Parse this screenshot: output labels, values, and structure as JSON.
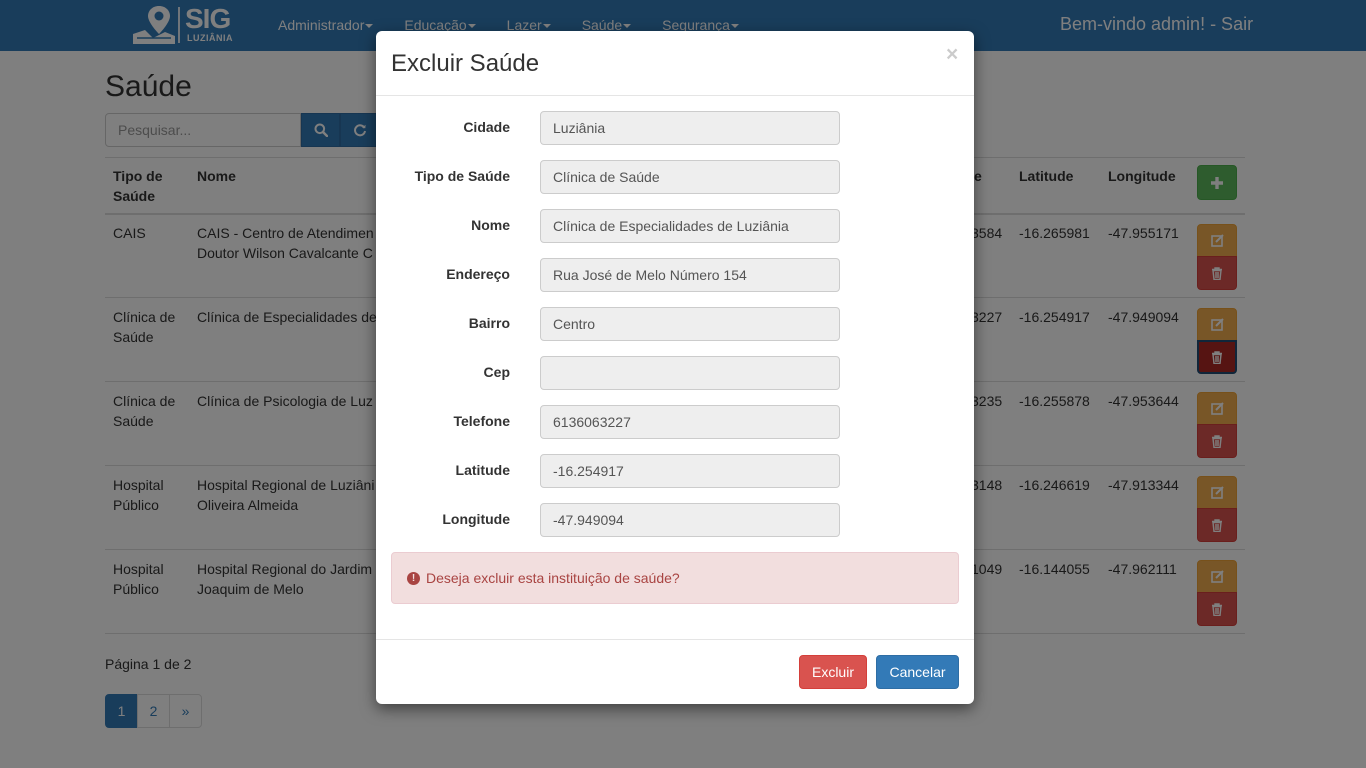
{
  "brand": {
    "name": "SIG",
    "city": "LUZIÂNIA"
  },
  "nav": {
    "items": [
      "Administrador",
      "Educação",
      "Lazer",
      "Saúde",
      "Segurança"
    ],
    "welcome": "Bem-vindo admin! - Sair"
  },
  "page": {
    "title": "Saúde"
  },
  "search": {
    "placeholder": "Pesquisar..."
  },
  "table": {
    "headers": {
      "tipo_line1": "Tipo de",
      "tipo_line2": "Saúde",
      "nome": "Nome",
      "telefone_tail": "e",
      "latitude": "Latitude",
      "longitude": "Longitude"
    },
    "rows": [
      {
        "tipo1": "CAIS",
        "tipo2": "",
        "nome1": "CAIS - Centro de Atendimen",
        "nome2": "Doutor Wilson Cavalcante C",
        "tel": "3584",
        "lat": "-16.265981",
        "lng": "-47.955171"
      },
      {
        "tipo1": "Clínica de",
        "tipo2": "Saúde",
        "nome1": "Clínica de Especialidades de",
        "nome2": "",
        "tel": "3227",
        "lat": "-16.254917",
        "lng": "-47.949094"
      },
      {
        "tipo1": "Clínica de",
        "tipo2": "Saúde",
        "nome1": "Clínica de Psicologia de Luz",
        "nome2": "",
        "tel": "3235",
        "lat": "-16.255878",
        "lng": "-47.953644"
      },
      {
        "tipo1": "Hospital",
        "tipo2": "Público",
        "nome1": "Hospital Regional de Luziâni",
        "nome2": "Oliveira Almeida",
        "tel": "3148",
        "lat": "-16.246619",
        "lng": "-47.913344"
      },
      {
        "tipo1": "Hospital",
        "tipo2": "Público",
        "nome1": "Hospital Regional do Jardim",
        "nome2": "Joaquim de Melo",
        "tel": "1049",
        "lat": "-16.144055",
        "lng": "-47.962111"
      }
    ]
  },
  "pagination": {
    "info": "Página 1 de 2",
    "pages": [
      "1",
      "2",
      "»"
    ]
  },
  "modal": {
    "title": "Excluir Saúde",
    "close": "×",
    "fields": [
      {
        "label": "Cidade",
        "value": "Luziânia"
      },
      {
        "label": "Tipo de Saúde",
        "value": "Clínica de Saúde"
      },
      {
        "label": "Nome",
        "value": "Clínica de Especialidades de Luziânia"
      },
      {
        "label": "Endereço",
        "value": "Rua José de Melo Número 154"
      },
      {
        "label": "Bairro",
        "value": "Centro"
      },
      {
        "label": "Cep",
        "value": ""
      },
      {
        "label": "Telefone",
        "value": "6136063227"
      },
      {
        "label": "Latitude",
        "value": "-16.254917"
      },
      {
        "label": "Longitude",
        "value": "-47.949094"
      }
    ],
    "alert": "Deseja excluir esta instituição de saúde?",
    "confirm": "Excluir",
    "cancel": "Cancelar"
  },
  "colors": {
    "primary": "#337ab7",
    "success": "#5cb85c",
    "warning": "#f0ad4e",
    "danger": "#d9534f"
  },
  "icons": {
    "search": "search-icon",
    "refresh": "refresh-icon",
    "add": "plus-icon",
    "edit": "edit-icon",
    "delete": "trash-icon",
    "alert": "exclamation-circle-icon"
  }
}
